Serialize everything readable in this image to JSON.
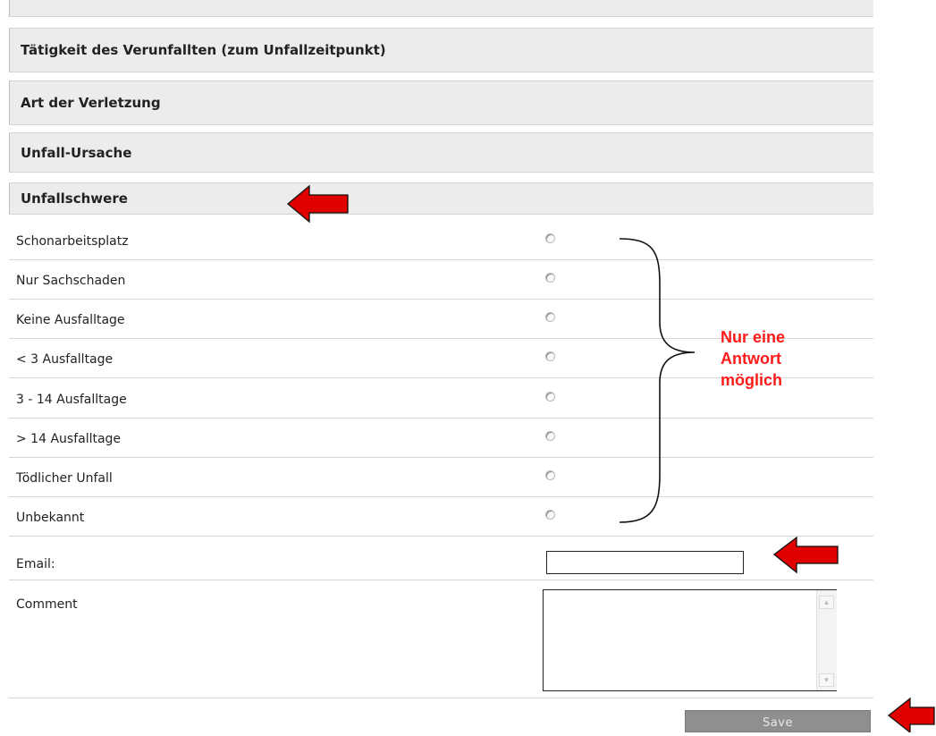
{
  "sections": [
    {
      "title": ""
    },
    {
      "title": "Tätigkeit des Verunfallten (zum Unfallzeitpunkt)"
    },
    {
      "title": "Art der Verletzung"
    },
    {
      "title": "Unfall-Ursache"
    },
    {
      "title": "Unfallschwere"
    }
  ],
  "options": [
    {
      "label": "Schonarbeitsplatz",
      "selected": false
    },
    {
      "label": "Nur Sachschaden",
      "selected": false
    },
    {
      "label": "Keine Ausfalltage",
      "selected": false
    },
    {
      "label": "< 3 Ausfalltage",
      "selected": false
    },
    {
      "label": "3 - 14 Ausfalltage",
      "selected": false
    },
    {
      "label": "> 14 Ausfalltage",
      "selected": false
    },
    {
      "label": "Tödlicher Unfall",
      "selected": false
    },
    {
      "label": "Unbekannt",
      "selected": false
    }
  ],
  "form": {
    "email_label": "Email:",
    "email_value": "",
    "comment_label": "Comment",
    "comment_value": "",
    "save_label": "Save"
  },
  "annotation": {
    "line1": "Nur eine",
    "line2": "Antwort",
    "line3": "möglich",
    "color": "#ff1a1a"
  },
  "colors": {
    "panel_bg": "#ececec",
    "button_bg": "#8f8f8f",
    "arrow": "#e00000"
  }
}
